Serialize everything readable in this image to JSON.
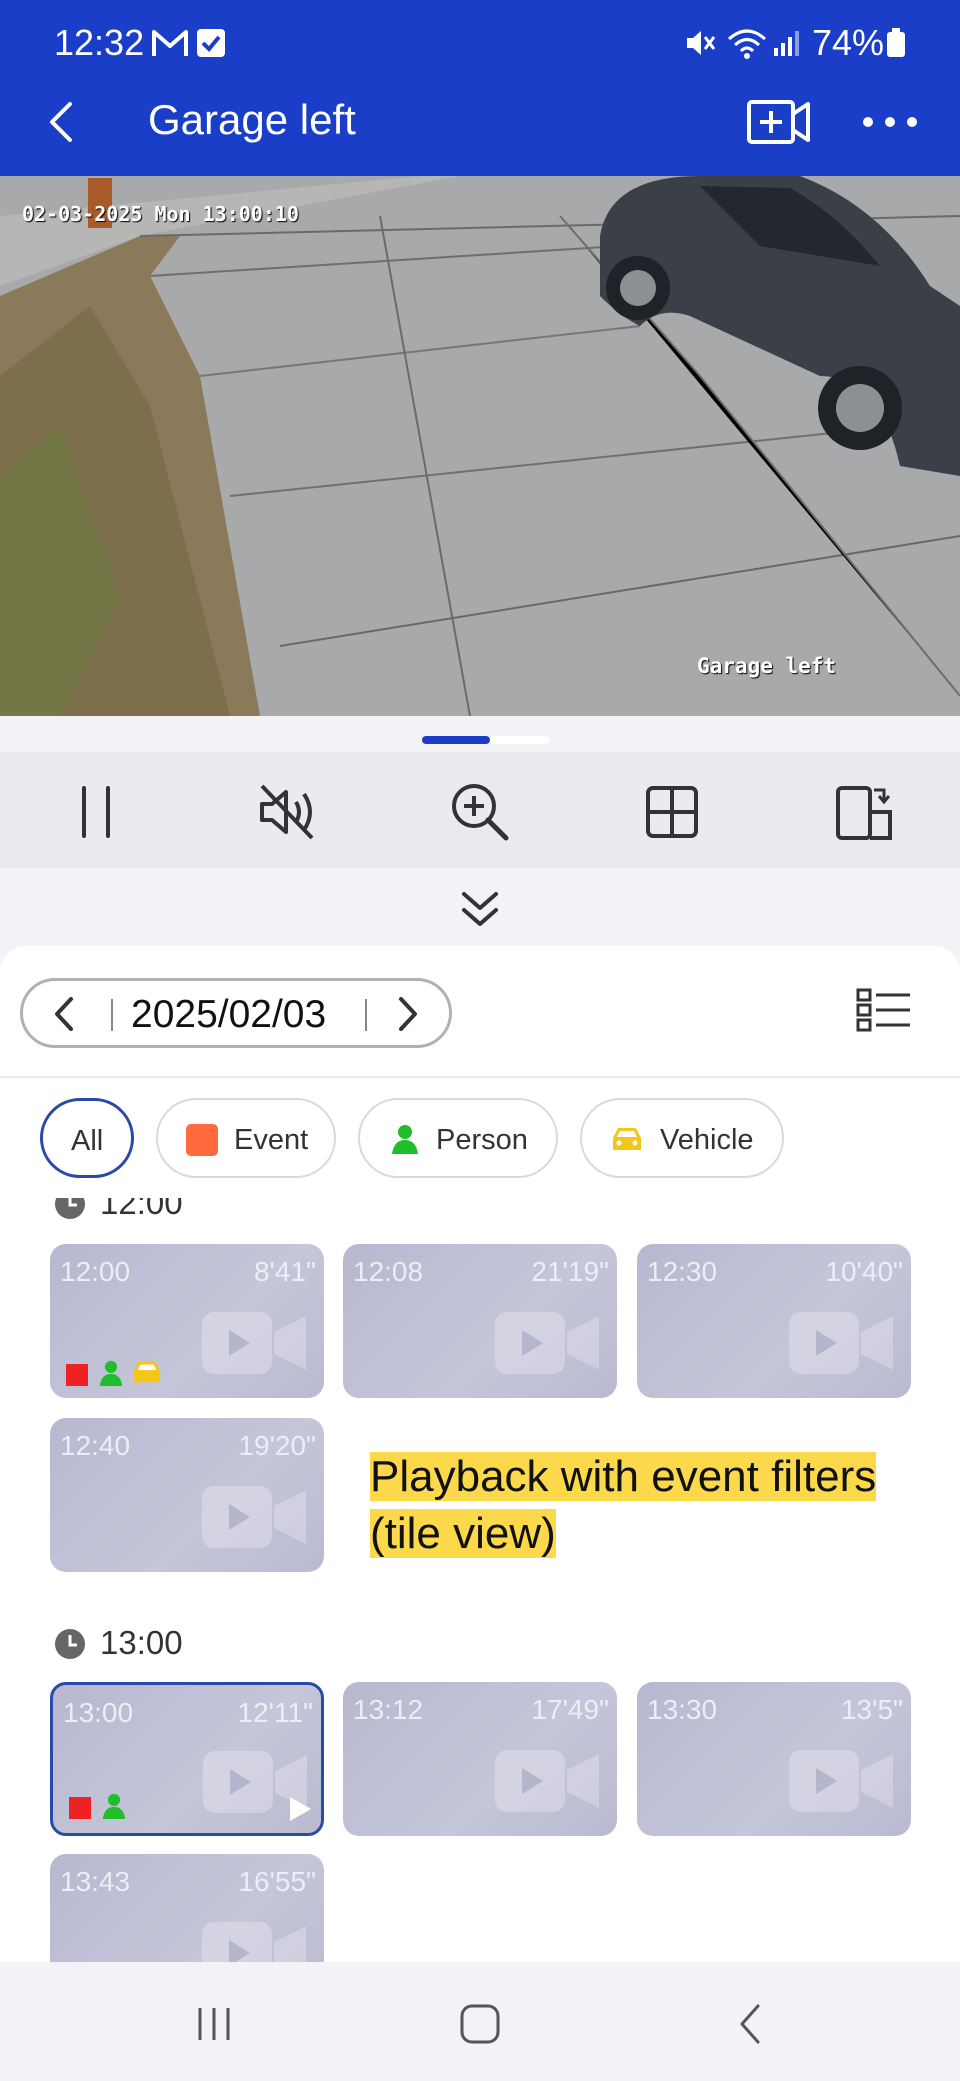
{
  "status_bar": {
    "time": "12:32",
    "battery": "74%"
  },
  "header": {
    "title": "Garage left"
  },
  "video": {
    "osd_time": "02-03-2025 Mon 13:00:10",
    "osd_name": "Garage left"
  },
  "date_bar": {
    "date": "2025/02/03"
  },
  "filters": [
    {
      "label": "All",
      "active": true
    },
    {
      "label": "Event",
      "color": "#ff6b3d"
    },
    {
      "label": "Person",
      "color": "#1fbe2a"
    },
    {
      "label": "Vehicle",
      "color": "#f5c518"
    }
  ],
  "sections": [
    {
      "hour": "12:00",
      "clips": [
        {
          "start": "12:00",
          "duration": "8'41\"",
          "badges": [
            "event",
            "person",
            "vehicle"
          ]
        },
        {
          "start": "12:08",
          "duration": "21'19\""
        },
        {
          "start": "12:30",
          "duration": "10'40\""
        },
        {
          "start": "12:40",
          "duration": "19'20\""
        }
      ]
    },
    {
      "hour": "13:00",
      "clips": [
        {
          "start": "13:00",
          "duration": "12'11\"",
          "badges": [
            "event",
            "person"
          ],
          "selected": true,
          "playing": true
        },
        {
          "start": "13:12",
          "duration": "17'49\""
        },
        {
          "start": "13:30",
          "duration": "13'5\""
        },
        {
          "start": "13:43",
          "duration": "16'55\""
        }
      ]
    }
  ],
  "annotation": {
    "text": "Playback with event filters (tile view)"
  },
  "colors": {
    "header": "#1a3ec8",
    "accent": "#2a4aa8",
    "event": "#ee2222",
    "person": "#1fbe2a",
    "vehicle": "#f5c518"
  }
}
